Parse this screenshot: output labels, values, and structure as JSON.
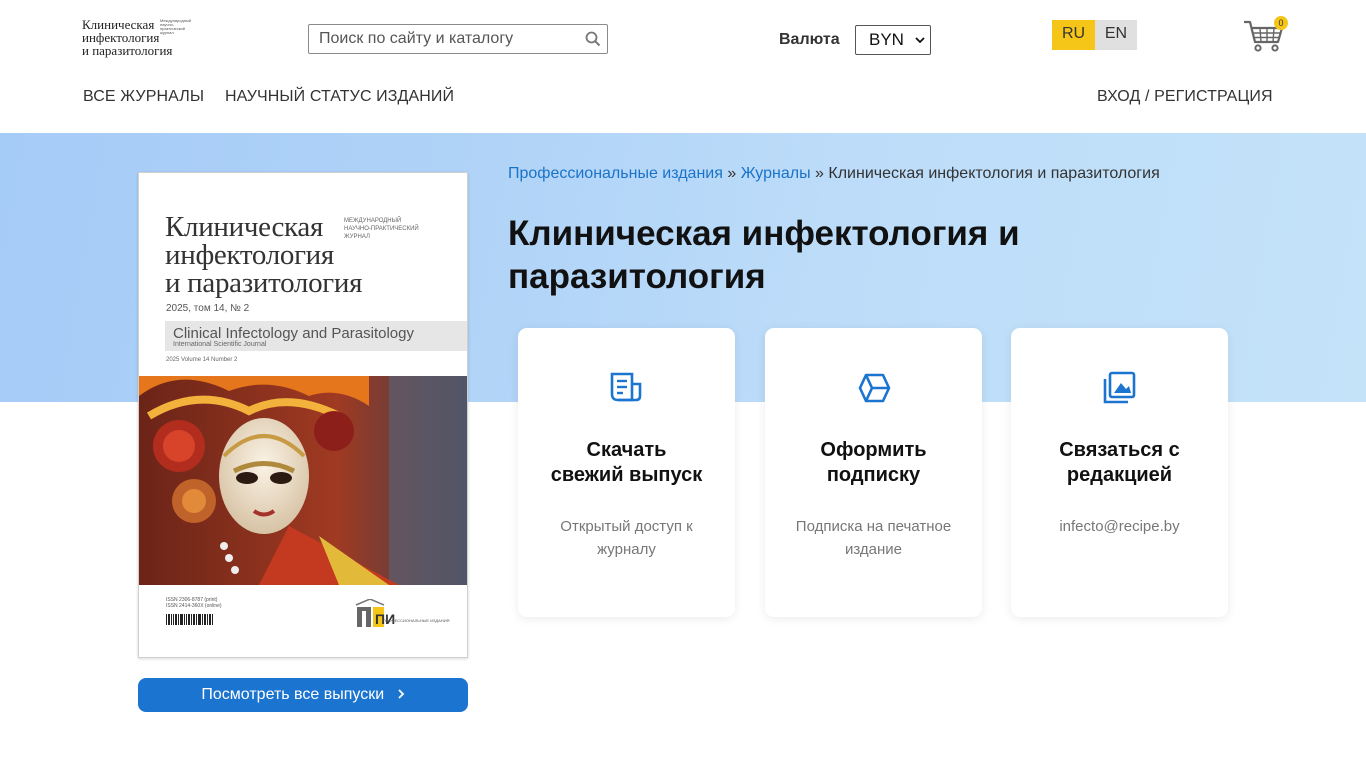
{
  "header": {
    "logo": {
      "lines": [
        "Клиническая",
        "инфектология",
        "и паразитология"
      ],
      "tiny": "Международный научно-практический журнал"
    },
    "search": {
      "placeholder": "Поиск по сайту и каталогу",
      "icon": "search-icon"
    },
    "currency": {
      "label": "Валюта",
      "selected": "BYN"
    },
    "languages": [
      {
        "label": "RU",
        "active": true,
        "color": "#f5c518"
      },
      {
        "label": "EN",
        "active": false,
        "color": "#e0e0e0"
      }
    ],
    "cart": {
      "icon": "cart-icon",
      "count": "0"
    }
  },
  "nav": {
    "all_journals": "Все журналы",
    "scientific_status": "Научный статус изданий",
    "login": "Вход / Регистрация"
  },
  "breadcrumb": {
    "items": [
      {
        "label": "Профессиональные издания",
        "link": true
      },
      {
        "label": "Журналы",
        "link": true
      },
      {
        "label": "Клиническая инфектология и паразитология",
        "link": false
      }
    ],
    "separator": "»"
  },
  "page": {
    "title_line1": "Клиническая инфектология и",
    "title_line2": "паразитология"
  },
  "cover": {
    "title_lines": [
      "Клиническая",
      "инфектология",
      "и паразитология"
    ],
    "small": "Международный научно-практический журнал",
    "year_ru": "2025, том 14, № 2",
    "title_en": "Clinical Infectology and Parasitology",
    "subtitle_en": "International Scientific Journal",
    "year_en": "2025 Volume 14 Number 2",
    "issn_print": "ISSN 2306-8787 (print)",
    "issn_online": "ISSN 2414-360X (online)",
    "publisher": "Профессиональные издания",
    "publisher_logo": "ПИ"
  },
  "all_issues_button": {
    "label": "Посмотреть все выпуски",
    "icon": "chevron-right-icon"
  },
  "cards": [
    {
      "icon": "document-icon",
      "title_line1": "Скачать",
      "title_line2": "свежий выпуск",
      "text_line1": "Открытый доступ к",
      "text_line2": "журналу"
    },
    {
      "icon": "box-icon",
      "title_line1": "Оформить",
      "title_line2": "подписку",
      "text_line1": "Подписка на печатное",
      "text_line2": "издание"
    },
    {
      "icon": "image-icon",
      "title_line1": "Связаться с",
      "title_line2": "редакцией",
      "text_line1": "infecto@recipe.by",
      "text_line2": ""
    }
  ],
  "colors": {
    "accent": "#1b74d0",
    "link": "#1a73c8",
    "lang_active": "#f5c518"
  }
}
